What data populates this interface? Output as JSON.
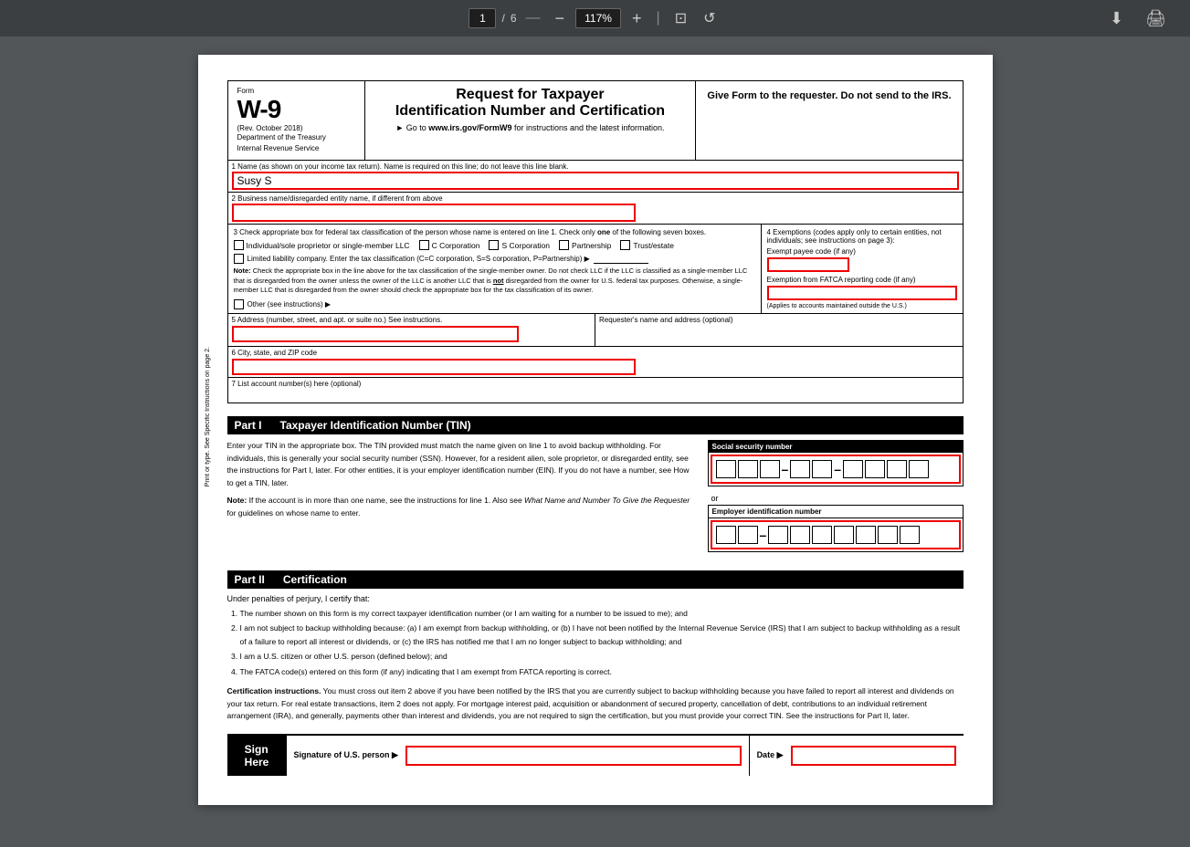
{
  "toolbar": {
    "page_current": "1",
    "page_total": "6",
    "zoom": "117%",
    "download_icon": "⬇",
    "print_icon": "🖨"
  },
  "document": {
    "form_label": "Form",
    "form_name": "W-9",
    "form_rev": "(Rev. October 2018)",
    "form_dept": "Department of the Treasury\nInternal Revenue Service",
    "form_title": "Request for Taxpayer",
    "form_subtitle": "Identification Number and Certification",
    "form_go": "Go to www.irs.gov/FormW9 for instructions and the latest information.",
    "form_give": "Give Form to the requester. Do not send to the IRS.",
    "sidebar_text": "Print or type. See Specific Instructions on page 2.",
    "line1_label": "1  Name (as shown on your income tax return). Name is required on this line; do not leave this line blank.",
    "line1_value": "Susy S",
    "line2_label": "2  Business name/disregarded entity name, if different from above",
    "line2_value": "",
    "tax_class_label": "3  Check appropriate box for federal tax classification of the person whose name is entered on line 1. Check only one of the following seven boxes.",
    "check_only": "Check only",
    "one_text": "one",
    "of_following": "of the following seven boxes.",
    "do_not_check": "Do not check",
    "ind_label": "Individual/sole proprietor or single-member LLC",
    "c_corp_label": "C Corporation",
    "s_corp_label": "S Corporation",
    "partnership_label": "Partnership",
    "trust_label": "Trust/estate",
    "llc_label": "Limited liability company. Enter the tax classification (C=C corporation, S=S corporation, P=Partnership) ▶",
    "llc_input_value": "",
    "note_label": "Note:",
    "note_text": "Check the appropriate box in the line above for the tax classification of the single-member owner.  Do not check LLC if the LLC is classified as a single-member LLC that is disregarded from the owner unless the owner of the LLC is another LLC that is not disregarded from the owner for U.S. federal tax purposes. Otherwise, a single-member LLC that is disregarded from the owner should check the appropriate box for the tax classification of its owner.",
    "not_text": "not",
    "other_label": "Other (see instructions) ▶",
    "exemptions_title": "4  Exemptions (codes apply only to certain entities, not individuals; see instructions on page 3):",
    "exempt_payee_label": "Exempt payee code (if any)",
    "exempt_payee_value": "",
    "fatca_label": "Exemption from FATCA reporting code (if any)",
    "fatca_value": "",
    "fatca_note": "(Applies to accounts maintained outside the U.S.)",
    "line5_label": "5  Address (number, street, and apt. or suite no.) See instructions.",
    "line5_value": "",
    "requester_label": "Requester's name and address (optional)",
    "line6_label": "6  City, state, and ZIP code",
    "line6_value": "",
    "line7_label": "7  List account number(s) here (optional)",
    "line7_value": "",
    "part1_number": "Part I",
    "part1_title": "Taxpayer Identification Number (TIN)",
    "tin_body": "Enter your TIN in the appropriate box. The TIN provided must match the name given on line 1 to avoid backup withholding. For individuals, this is generally your social security number (SSN). However, for a resident alien, sole proprietor, or disregarded entity, see the instructions for Part I, later. For other entities, it is your employer identification number (EIN). If you do not have a number, see How to get a TIN, later.",
    "tin_note": "Note:",
    "tin_note_text": " If the account is in more than one name, see the instructions for line 1. Also see What Name and Number To Give the Requester for guidelines on whose name to enter.",
    "ssn_label": "Social security number",
    "or_text": "or",
    "ein_label": "Employer identification number",
    "part2_number": "Part II",
    "part2_title": "Certification",
    "cert_under": "Under penalties of perjury, I certify that:",
    "cert_items": [
      "The number shown on this form is my correct taxpayer identification number (or I am waiting for a number to be issued to me); and",
      "I am not subject to backup withholding because: (a) I am exempt from backup withholding, or (b) I have not been notified by the Internal Revenue Service (IRS) that I am subject to backup withholding as a result of a failure to report all interest or dividends, or (c) the IRS has notified me that I am no longer subject to backup withholding; and",
      "I am a U.S. citizen or other U.S. person (defined below); and",
      "The FATCA code(s) entered on this form (if any) indicating that I am exempt from FATCA reporting is correct."
    ],
    "cert_instructions_label": "Certification instructions.",
    "cert_instructions_text": "You must cross out item 2 above if you have been notified by the IRS that you are currently subject to backup withholding because you have failed to report all interest and dividends on your tax return. For real estate transactions, item 2 does not apply. For mortgage interest paid, acquisition or abandonment of secured property, cancellation of debt, contributions to an individual retirement arrangement (IRA), and generally, payments other than interest and dividends, you are not required to sign the certification, but you must provide your correct TIN. See the instructions for Part II, later.",
    "sign_label": "Sign\nHere",
    "sign_sub": "",
    "sig_label": "Signature of U.S. person ▶",
    "sig_value": "",
    "date_label": "Date ▶",
    "date_value": ""
  }
}
